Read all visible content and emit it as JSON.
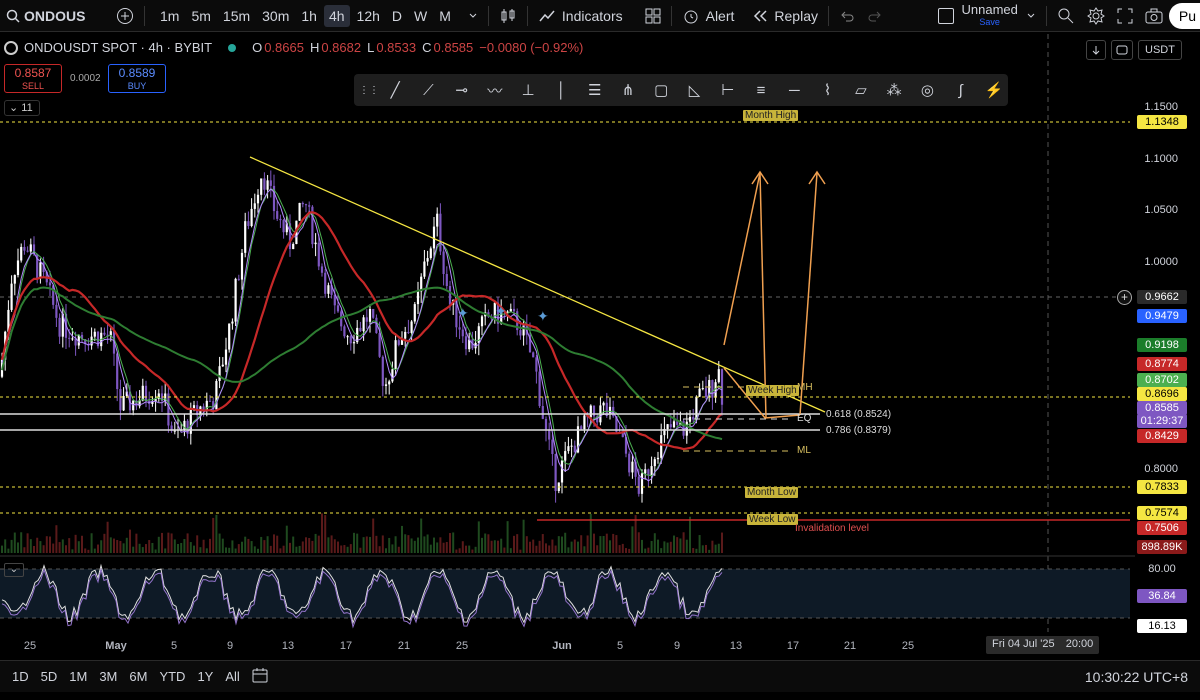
{
  "topbar": {
    "symbol": "ONDOUS",
    "intervals": [
      "1m",
      "5m",
      "15m",
      "30m",
      "1h",
      "4h",
      "12h",
      "D",
      "W",
      "M"
    ],
    "active_interval": "4h",
    "indicators_label": "Indicators",
    "alert_label": "Alert",
    "replay_label": "Replay",
    "layout_name": "Unnamed",
    "layout_sub": "Save",
    "publish_label": "Pu"
  },
  "legend": {
    "title": "ONDOUSDT SPOT · 4h · BYBIT",
    "o_label": "O",
    "o": "0.8665",
    "h_label": "H",
    "h": "0.8682",
    "l_label": "L",
    "l": "0.8533",
    "c_label": "C",
    "c": "0.8585",
    "change": "−0.0080 (−0.92%)",
    "sell_price": "0.8587",
    "sell_label": "SELL",
    "buy_price": "0.8589",
    "buy_label": "BUY",
    "spread": "0.0002",
    "indicator_count": "11"
  },
  "right_controls": {
    "currency": "USDT"
  },
  "price_axis": [
    "1.1500",
    "1.1000",
    "1.0500",
    "1.0000",
    "0.8000"
  ],
  "price_tags": [
    {
      "value": "1.1348",
      "bg": "#f5e642",
      "fg": "#000"
    },
    {
      "value": "0.9662",
      "bg": "#2a2a2a",
      "fg": "#fff"
    },
    {
      "value": "0.9479",
      "bg": "#2962ff",
      "fg": "#fff"
    },
    {
      "value": "0.9198",
      "bg": "#1b7d2a",
      "fg": "#fff"
    },
    {
      "value": "0.8774",
      "bg": "#c62828",
      "fg": "#fff"
    },
    {
      "value": "0.8702",
      "bg": "#4caf50",
      "fg": "#fff"
    },
    {
      "value": "0.8696",
      "bg": "#f5e642",
      "fg": "#000"
    },
    {
      "value": "0.8585",
      "bg": "#7e57c2",
      "fg": "#fff"
    },
    {
      "value": "01:29:37",
      "bg": "#7e57c2",
      "fg": "#fff"
    },
    {
      "value": "0.8429",
      "bg": "#c62828",
      "fg": "#fff"
    },
    {
      "value": "0.7833",
      "bg": "#f5e642",
      "fg": "#000"
    },
    {
      "value": "0.7574",
      "bg": "#f5e642",
      "fg": "#000"
    },
    {
      "value": "0.7506",
      "bg": "#c62828",
      "fg": "#fff"
    },
    {
      "value": "898.89K",
      "bg": "#8b1a1a",
      "fg": "#fff"
    }
  ],
  "annotations": {
    "month_high": "Month High",
    "week_high": "Week High",
    "mh": "MH",
    "eq": "EQ",
    "ml": "ML",
    "month_low": "Month Low",
    "week_low": "Week Low",
    "invalidation": "Invalidation level",
    "fib_618": "0.618 (0.8524)",
    "fib_786": "0.786 (0.8379)"
  },
  "rsi_axis": [
    "80.00",
    "36.84",
    "16.13"
  ],
  "time_axis": [
    "25",
    "May",
    "5",
    "9",
    "13",
    "17",
    "21",
    "25",
    "Jun",
    "5",
    "9",
    "13",
    "17",
    "21",
    "25"
  ],
  "crosshair_date": "Fri 04 Jul '25",
  "crosshair_time": "20:00",
  "bottombar": {
    "ranges": [
      "1D",
      "5D",
      "1M",
      "3M",
      "6M",
      "YTD",
      "1Y",
      "All"
    ],
    "clock": "10:30:22 UTC+8"
  },
  "colors": {
    "up": "#ffffff",
    "down": "#7e57c2",
    "ma_red": "#c62828",
    "ma_green": "#2e7d32",
    "trendline": "#f5e642",
    "arrow": "#f0a050"
  }
}
